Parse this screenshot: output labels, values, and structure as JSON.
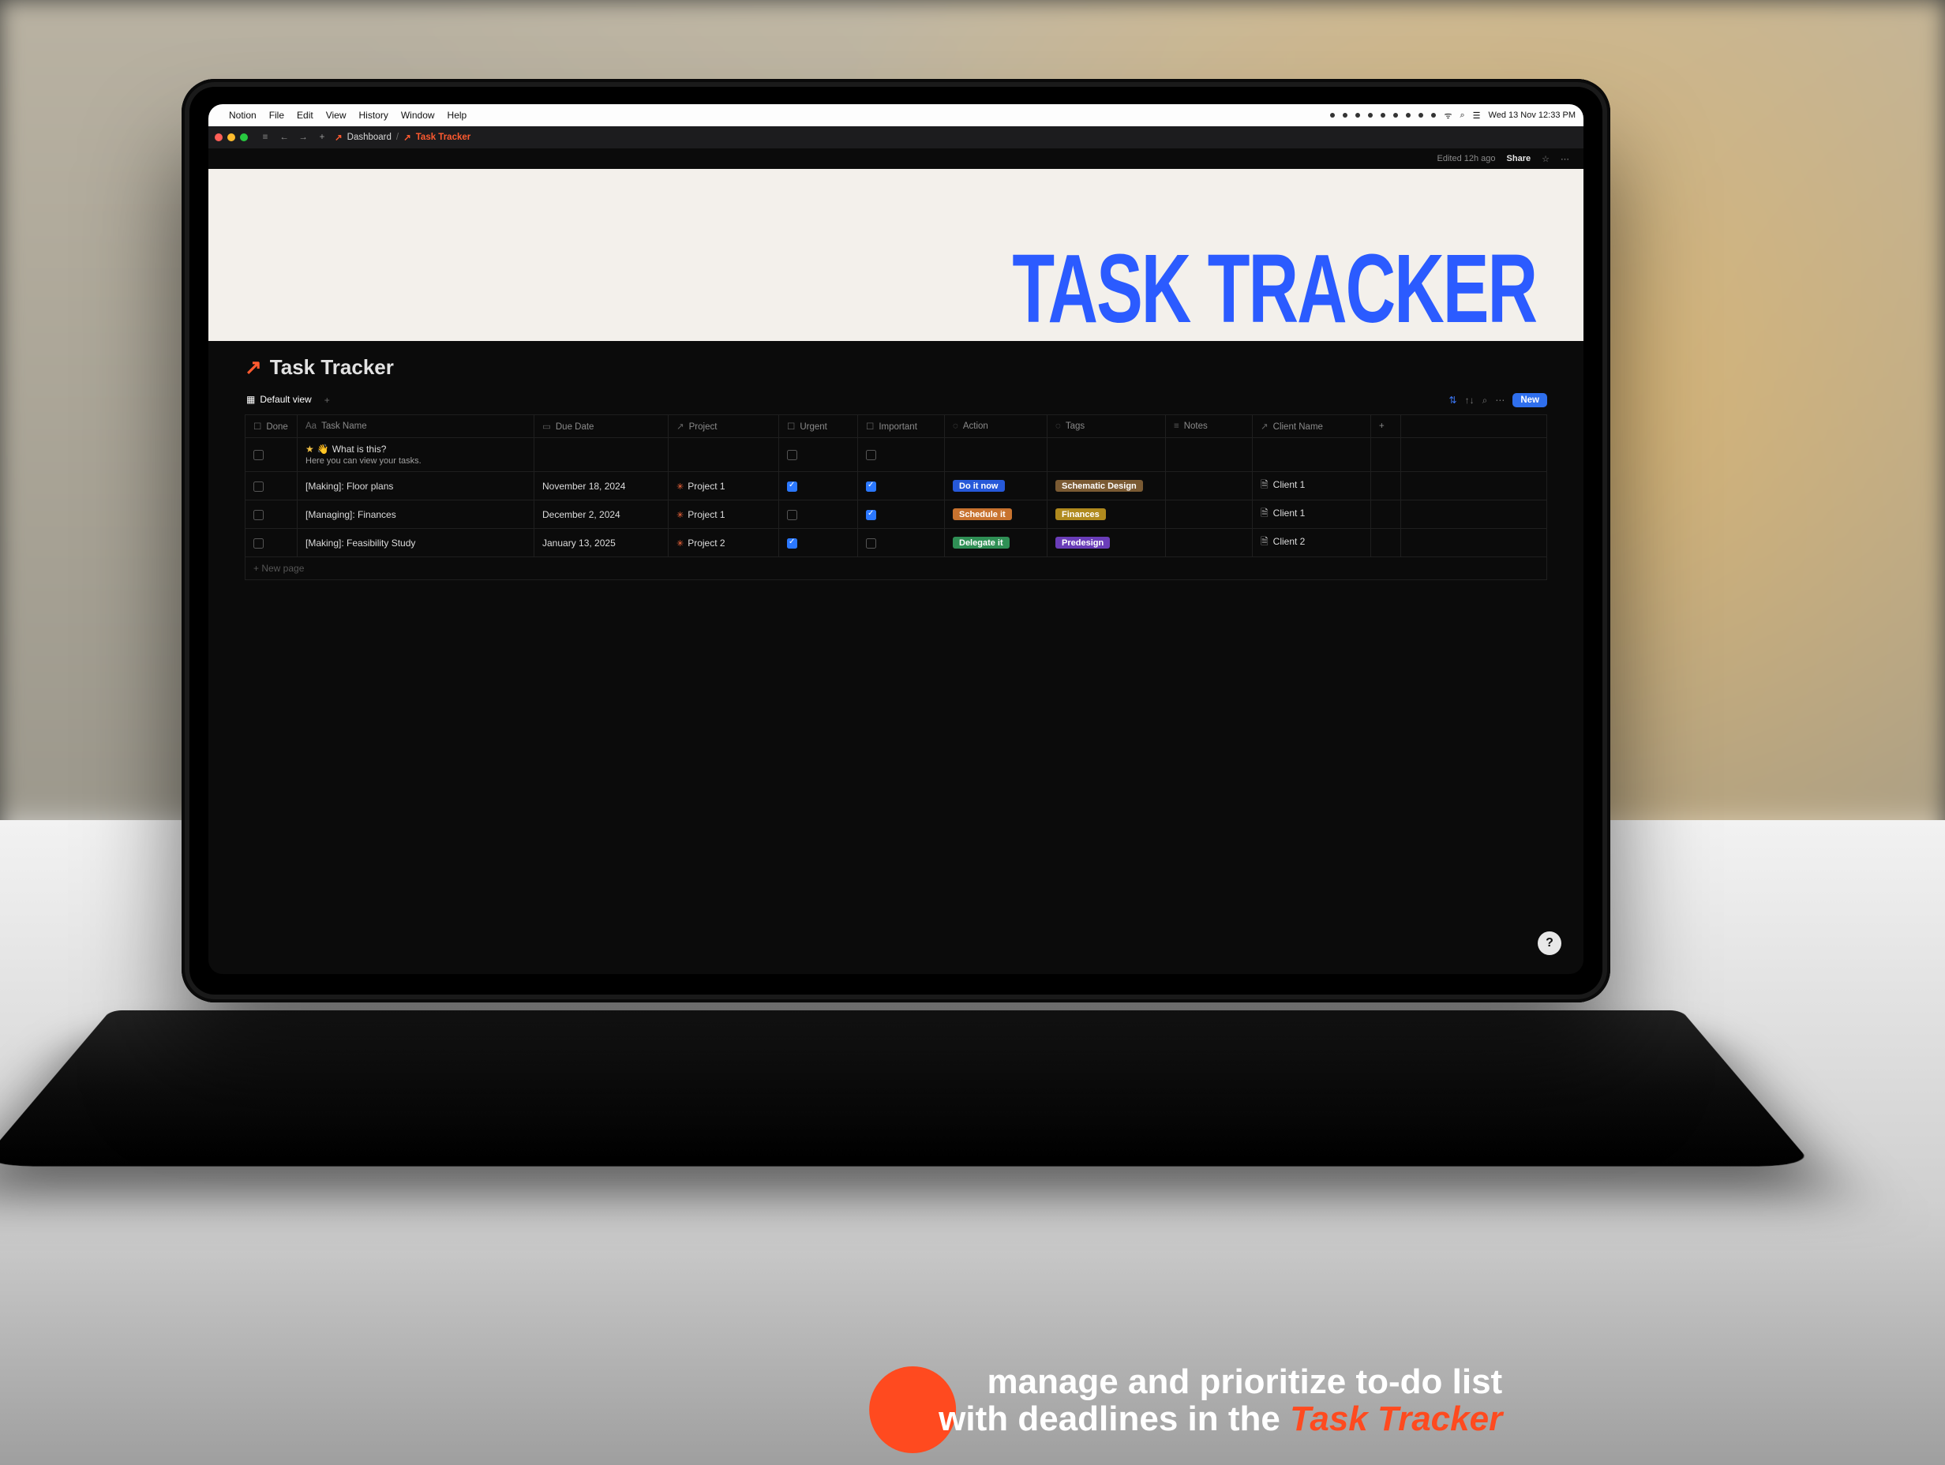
{
  "menubar": {
    "app": "Notion",
    "items": [
      "File",
      "Edit",
      "View",
      "History",
      "Window",
      "Help"
    ],
    "clock": "Wed 13 Nov 12:33 PM"
  },
  "browser": {
    "breadcrumb": {
      "root_icon": "↗",
      "root": "Dashboard",
      "current": "Task Tracker"
    }
  },
  "notion_top": {
    "edited": "Edited 12h ago",
    "share": "Share"
  },
  "cover": {
    "title": "TASK TRACKER"
  },
  "page": {
    "icon": "↗",
    "title": "Task Tracker",
    "view_tab": "Default view",
    "new_button": "New",
    "new_row": "New page"
  },
  "columns": {
    "done": "Done",
    "name": "Task Name",
    "date": "Due Date",
    "project": "Project",
    "urgent": "Urgent",
    "important": "Important",
    "action": "Action",
    "tags": "Tags",
    "notes": "Notes",
    "client": "Client Name",
    "add": "+"
  },
  "rows": [
    {
      "done": false,
      "name": "What is this?",
      "name_prefix": "star-wave",
      "sub": "Here you can view your tasks.",
      "date": "",
      "project": "",
      "urgent": false,
      "important": false,
      "action": "",
      "action_color": "",
      "tag": "",
      "tag_color": "",
      "client": ""
    },
    {
      "done": false,
      "name": "[Making]: Floor plans",
      "date": "November 18, 2024",
      "project": "Project 1",
      "urgent": true,
      "important": true,
      "action": "Do it now",
      "action_color": "blue",
      "tag": "Schematic Design",
      "tag_color": "brown",
      "client": "Client 1"
    },
    {
      "done": false,
      "name": "[Managing]: Finances",
      "date": "December 2, 2024",
      "project": "Project 1",
      "urgent": false,
      "important": true,
      "action": "Schedule it",
      "action_color": "orange",
      "tag": "Finances",
      "tag_color": "yellow",
      "client": "Client 1"
    },
    {
      "done": false,
      "name": "[Making]: Feasibility Study",
      "date": "January 13, 2025",
      "project": "Project 2",
      "urgent": true,
      "important": false,
      "action": "Delegate it",
      "action_color": "green",
      "tag": "Predesign",
      "tag_color": "purple",
      "client": "Client 2"
    }
  ],
  "caption": {
    "line1": "manage and prioritize to-do list",
    "line2_a": "with deadlines in the ",
    "line2_b": "Task Tracker"
  },
  "help": "?"
}
